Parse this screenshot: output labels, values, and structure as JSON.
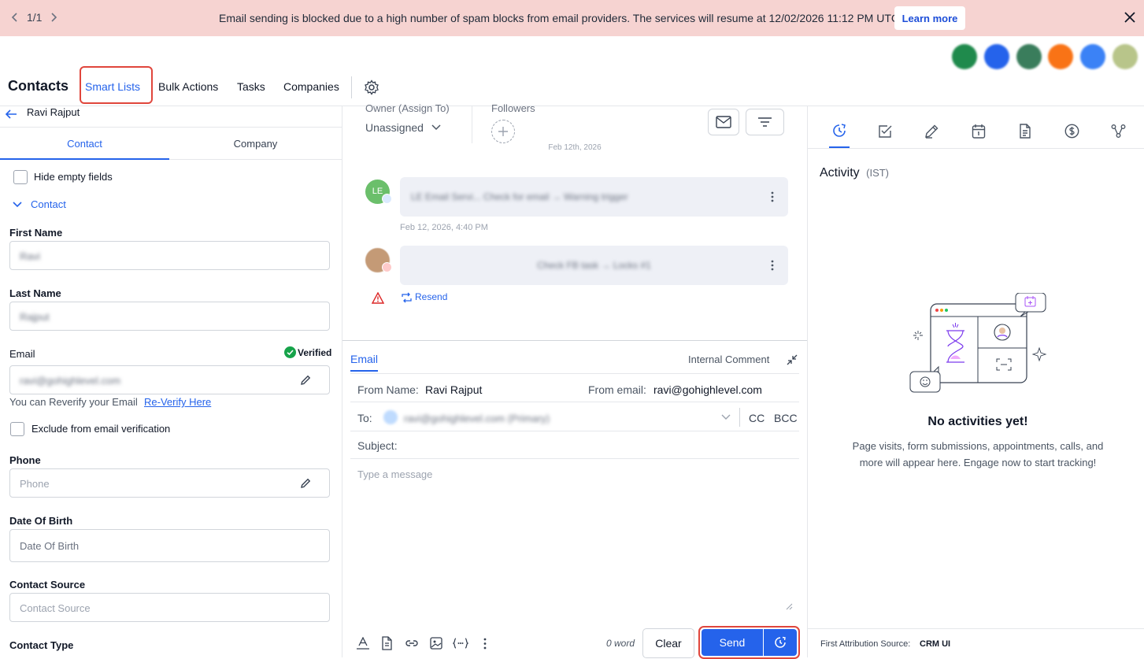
{
  "banner": {
    "pager": "1/1",
    "message": "Email sending is blocked due to a high number of spam blocks from email providers. The services will resume at 12/02/2026 11:12 PM UTC.",
    "learn_more": "Learn more"
  },
  "app_icons": [
    {
      "name": "phone-app-icon",
      "color": "#1f8a4c"
    },
    {
      "name": "link-app-icon",
      "color": "#2563eb"
    },
    {
      "name": "chat-app-icon",
      "color": "#3a7d5c"
    },
    {
      "name": "notification-app-icon",
      "color": "#f97316"
    },
    {
      "name": "help-app-icon",
      "color": "#3b82f6"
    },
    {
      "name": "avatar-app-icon",
      "color": "#b8c58a"
    }
  ],
  "nav": {
    "title": "Contacts",
    "tabs": [
      "Smart Lists",
      "Bulk Actions",
      "Tasks",
      "Companies"
    ],
    "active_tab": "Smart Lists"
  },
  "contact": {
    "back_name": "Ravi Rajput",
    "tabs": [
      "Contact",
      "Company"
    ],
    "hide_empty": "Hide empty fields",
    "section": "Contact",
    "first_name_label": "First Name",
    "first_name_value": "Ravi",
    "last_name_label": "Last Name",
    "last_name_value": "Rajput",
    "email_label": "Email",
    "verified": "Verified",
    "email_value": "ravi@gohighlevel.com",
    "reverify_text": "You can Reverify your Email",
    "reverify_link": "Re-Verify Here",
    "exclude_label": "Exclude from email verification",
    "phone_label": "Phone",
    "phone_placeholder": "Phone",
    "dob_label": "Date Of Birth",
    "dob_placeholder": "Date Of Birth",
    "source_label": "Contact Source",
    "source_placeholder": "Contact Source",
    "type_label": "Contact Type"
  },
  "conversation": {
    "owner_label": "Owner (Assign To)",
    "owner_value": "Unassigned",
    "followers_label": "Followers",
    "date_chip": "Feb 12th, 2026",
    "msg1_avatar": "LE",
    "msg1_text": "LE Email Servi...   Check for email  →  Warning trigger",
    "msg1_time": "Feb 12, 2026, 4:40 PM",
    "msg2_text": "Check FB task  →  Locks #1",
    "resend": "Resend"
  },
  "composer": {
    "tab_email": "Email",
    "tab_internal": "Internal Comment",
    "from_name_label": "From Name:",
    "from_name_value": "Ravi Rajput",
    "from_email_label": "From email:",
    "from_email_value": "ravi@gohighlevel.com",
    "to_label": "To:",
    "to_value": "ravi@gohighlevel.com (Primary)",
    "cc": "CC",
    "bcc": "BCC",
    "subject_label": "Subject:",
    "message_placeholder": "Type a message",
    "word_count": "0 word",
    "clear": "Clear",
    "send": "Send"
  },
  "activity": {
    "title": "Activity",
    "tz": "(IST)",
    "empty_title": "No activities yet!",
    "empty_line1": "Page visits, form submissions, appointments, calls, and",
    "empty_line2": "more will appear here. Engage now to start tracking!",
    "attribution_label": "First Attribution Source:",
    "attribution_value": "CRM UI"
  },
  "colors": {
    "accent": "#2563eb",
    "banner_bg": "#f6d3d1",
    "highlight": "#e0463c",
    "send_bg": "#2563eb"
  }
}
